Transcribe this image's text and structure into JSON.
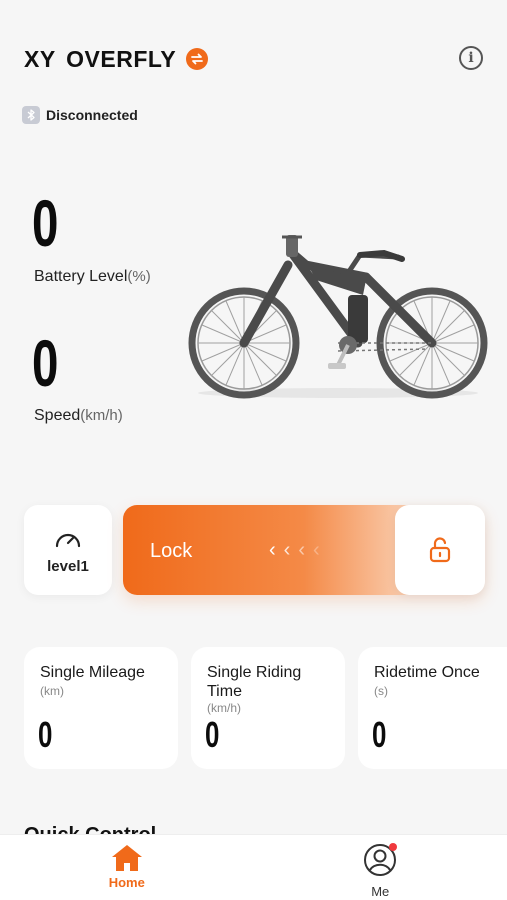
{
  "header": {
    "title": "XY  OVERFLY",
    "switch_icon": "switch-icon",
    "info_icon": "info-icon"
  },
  "connection": {
    "status": "Disconnected",
    "icon": "bluetooth-icon"
  },
  "stats": {
    "battery": {
      "value": "0",
      "label": "Battery Level",
      "unit": "(%)"
    },
    "speed": {
      "value": "0",
      "label": "Speed",
      "unit": "(km/h)"
    }
  },
  "controls": {
    "level": {
      "label": "level1",
      "icon": "speedometer-icon"
    },
    "lock": {
      "label": "Lock",
      "chevrons": [
        "‹",
        "‹",
        "‹",
        "‹"
      ],
      "icon": "unlock-icon"
    }
  },
  "metrics": [
    {
      "title": "Single Mileage",
      "unit": "(km)",
      "value": "0"
    },
    {
      "title": "Single Riding Time",
      "unit": "(km/h)",
      "value": "0"
    },
    {
      "title": "Ridetime Once",
      "unit": "(s)",
      "value": "0"
    }
  ],
  "section": {
    "title": "Quick Control"
  },
  "tabs": [
    {
      "label": "Home",
      "icon": "home-icon",
      "active": true
    },
    {
      "label": "Me",
      "icon": "user-icon",
      "active": false
    }
  ],
  "colors": {
    "accent": "#f06a1a",
    "notification": "#f0393d"
  }
}
